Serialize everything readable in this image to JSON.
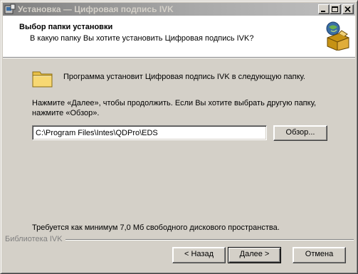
{
  "window": {
    "title": "Установка — Цифровая подпись IVK"
  },
  "header": {
    "title": "Выбор папки установки",
    "subtitle": "В какую папку Вы хотите установить Цифровая подпись IVK?",
    "icon": "installer-box-icon"
  },
  "body": {
    "intro": "Программа установит Цифровая подпись IVK в следующую папку.",
    "hint": "Нажмите «Далее», чтобы продолжить. Если Вы хотите выбрать другую папку, нажмите «Обзор».",
    "path_value": "C:\\Program Files\\Intes\\QDPro\\EDS",
    "browse_label": "Обзор...",
    "space_required": "Требуется как минимум 7,0 Мб свободного дискового пространства."
  },
  "footer": {
    "brand": "Библиотека IVK",
    "back_label": "< Назад",
    "next_label": "Далее >",
    "cancel_label": "Отмена"
  },
  "colors": {
    "titlebar_start": "#808080",
    "face": "#d4d0c8",
    "folder": "#f5d56b"
  }
}
